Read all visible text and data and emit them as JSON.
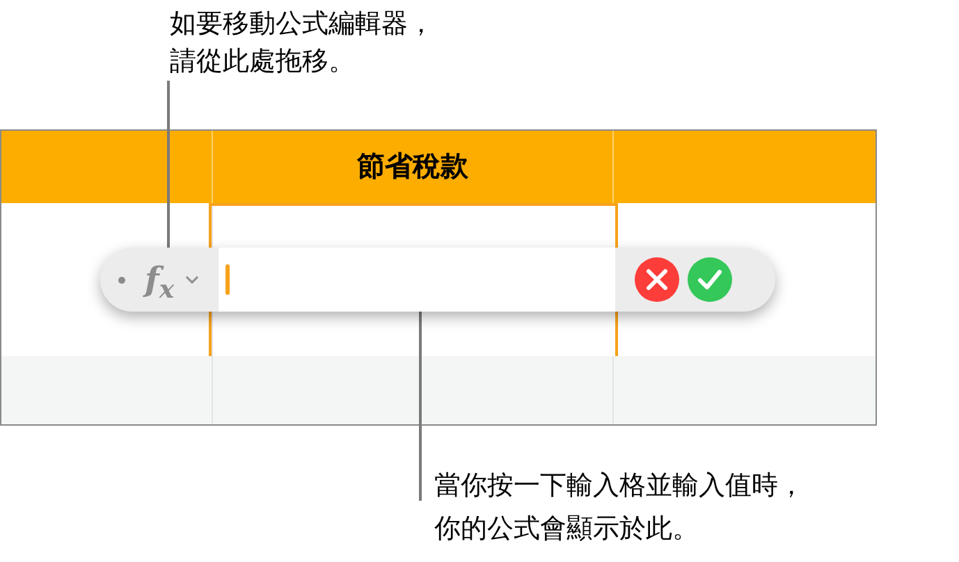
{
  "callouts": [
    {
      "lines": [
        "如要移動公式編輯器，",
        "請從此處拖移。"
      ]
    },
    {
      "lines": [
        "當你按一下輸入格並輸入值時，",
        "你的公式會顯示於此。"
      ]
    }
  ],
  "table": {
    "header_title": "節省稅款"
  },
  "formula_editor": {
    "symbol": "f$_{x}$"
  }
}
